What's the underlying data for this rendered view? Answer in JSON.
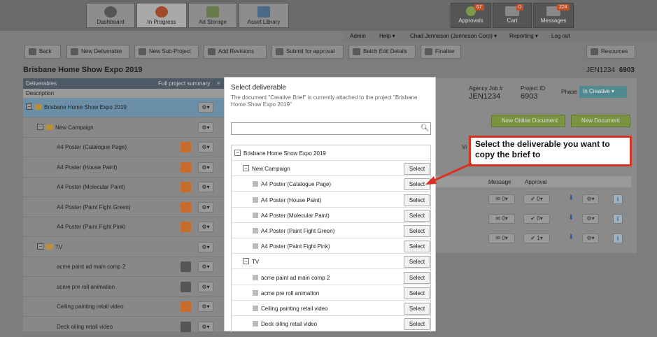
{
  "nav": {
    "dashboard": "Dashboard",
    "in_progress": "In Progress",
    "ad_storage": "Ad Storage",
    "asset_library": "Asset Library",
    "approvals": "Approvals",
    "approvals_count": "67",
    "cart": "Cart",
    "cart_count": "0",
    "messages": "Messages",
    "messages_count": "224"
  },
  "menubar": {
    "admin": "Admin",
    "help": "Help ▾",
    "user": "Chad Jenneson (Jenneson Corp) ▾",
    "reporting": "Reporting ▾",
    "logout": "Log out"
  },
  "toolbar": {
    "back": "Back",
    "new_deliverable": "New Deliverable",
    "new_subproject": "New Sub-Project",
    "add_revisions": "Add Revisions",
    "submit": "Submit for approval",
    "batch_edit": "Batch Edit Details",
    "finalise": "Finalise",
    "resources": "Resources"
  },
  "project": {
    "title": "Brisbane Home Show Expo 2019",
    "code": "JEN1234",
    "number": "6903",
    "agency_label": "Agency Job #",
    "agency_value": "JEN1234",
    "project_id_label": "Project ID",
    "project_id_value": "6903",
    "phase_label": "Phase",
    "phase_value": "In Creative ▾"
  },
  "left_panel": {
    "header": "Deliverables",
    "summary": "Full project summary",
    "desc_col": "Description",
    "rows": [
      {
        "label": "Brisbane Home Show Expo 2019",
        "level": 0,
        "type": "folder",
        "selected": true,
        "status": ""
      },
      {
        "label": "New Campaign",
        "level": 1,
        "type": "folder",
        "status": ""
      },
      {
        "label": "A4 Poster (Catalogue Page)",
        "level": 2,
        "type": "item",
        "status": "orange"
      },
      {
        "label": "A4 Poster (House Paint)",
        "level": 2,
        "type": "item",
        "status": "orange"
      },
      {
        "label": "A4 Poster (Molecular Paint)",
        "level": 2,
        "type": "item",
        "status": "orange"
      },
      {
        "label": "A4 Poster (Paint Fight Green)",
        "level": 2,
        "type": "item",
        "status": "orange"
      },
      {
        "label": "A4 Poster (Paint Fight Pink)",
        "level": 2,
        "type": "item",
        "status": "orange"
      },
      {
        "label": "TV",
        "level": 1,
        "type": "folder",
        "status": ""
      },
      {
        "label": "acme paint ad main comp 2",
        "level": 2,
        "type": "item",
        "status": "gray"
      },
      {
        "label": "acme pre roll animation",
        "level": 2,
        "type": "item",
        "status": "gray"
      },
      {
        "label": "Ceiling painting retail video",
        "level": 2,
        "type": "item",
        "status": "orange"
      },
      {
        "label": "Deck oiling retail video",
        "level": 2,
        "type": "item",
        "status": "gray"
      }
    ]
  },
  "right": {
    "new_online_doc": "New Online Document",
    "new_doc": "New Document",
    "view": "Vi",
    "message_col": "Message",
    "approval_col": "Approval",
    "rows": [
      {
        "msg": "0",
        "appr": "0"
      },
      {
        "msg": "0",
        "appr": "0"
      },
      {
        "msg": "0",
        "appr": "1"
      }
    ]
  },
  "modal": {
    "title": "Select deliverable",
    "description": "The document \"Creative Brief\" is currently attached to the project \"Brisbane Home Show Expo 2019\"",
    "search_placeholder": "",
    "select_label": "Select",
    "rows": [
      {
        "label": "Brisbane Home Show Expo 2019",
        "level": 0,
        "toggle": "−",
        "has_select": false
      },
      {
        "label": "New Campaign",
        "level": 1,
        "toggle": "−",
        "has_select": true
      },
      {
        "label": "A4 Poster (Catalogue Page)",
        "level": 2,
        "toggle": "",
        "has_select": true
      },
      {
        "label": "A4 Poster (House Paint)",
        "level": 2,
        "toggle": "",
        "has_select": true
      },
      {
        "label": "A4 Poster (Molecular Paint)",
        "level": 2,
        "toggle": "",
        "has_select": true
      },
      {
        "label": "A4 Poster (Paint Fight Green)",
        "level": 2,
        "toggle": "",
        "has_select": true
      },
      {
        "label": "A4 Poster (Paint Fight Pink)",
        "level": 2,
        "toggle": "",
        "has_select": true
      },
      {
        "label": "TV",
        "level": 1,
        "toggle": "−",
        "has_select": true
      },
      {
        "label": "acme paint ad main comp 2",
        "level": 2,
        "toggle": "",
        "has_select": true
      },
      {
        "label": "acme pre roll animation",
        "level": 2,
        "toggle": "",
        "has_select": true
      },
      {
        "label": "Ceiling painting retail video",
        "level": 2,
        "toggle": "",
        "has_select": true
      },
      {
        "label": "Deck oiling retail video",
        "level": 2,
        "toggle": "",
        "has_select": true
      }
    ]
  },
  "callout": {
    "text": "Select the deliverable you want to copy the brief to",
    "color": "#d93224"
  }
}
